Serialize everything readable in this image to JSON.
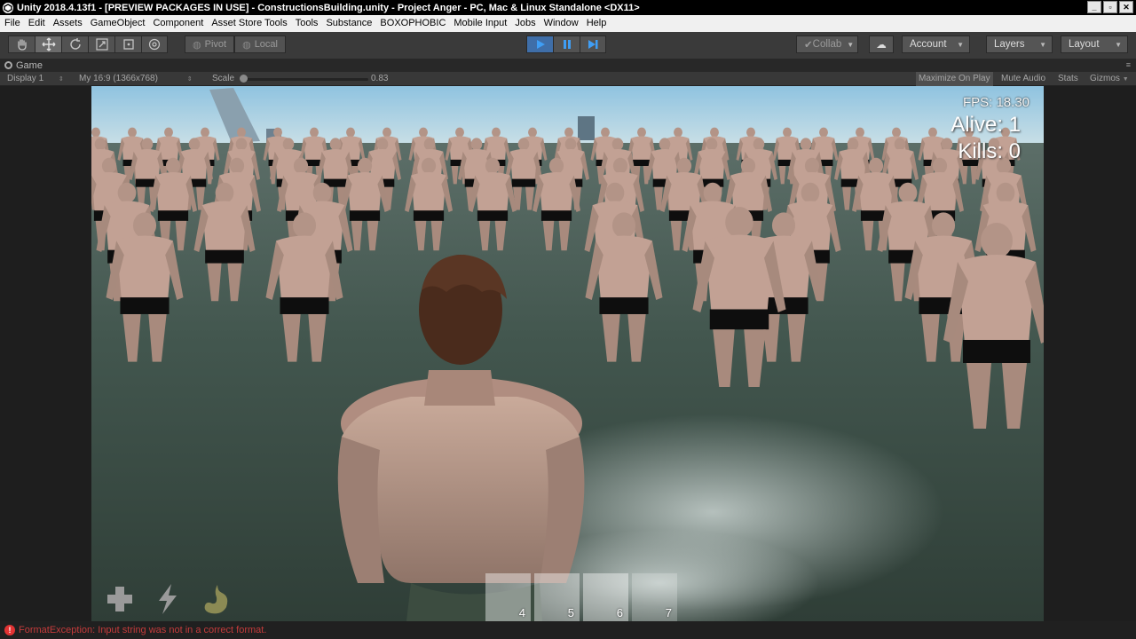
{
  "window": {
    "title": "Unity 2018.4.13f1 - [PREVIEW PACKAGES IN USE] - ConstructionsBuilding.unity - Project Anger - PC, Mac & Linux Standalone <DX11>"
  },
  "menu": [
    "File",
    "Edit",
    "Assets",
    "GameObject",
    "Component",
    "Asset Store Tools",
    "Tools",
    "Substance",
    "BOXOPHOBIC",
    "Mobile Input",
    "Jobs",
    "Window",
    "Help"
  ],
  "toolbar": {
    "pivot_label": "Pivot",
    "local_label": "Local",
    "collab_label": "Collab",
    "account_label": "Account",
    "layers_label": "Layers",
    "layout_label": "Layout"
  },
  "game_tab": {
    "label": "Game"
  },
  "game_toolbar": {
    "display": "Display 1",
    "resolution": "My 16:9 (1366x768)",
    "scale_label": "Scale",
    "scale_value": "0.83",
    "maximize": "Maximize On Play",
    "mute": "Mute Audio",
    "stats": "Stats",
    "gizmos": "Gizmos"
  },
  "hud": {
    "fps": "FPS: 18.30",
    "alive": "Alive: 1",
    "kills": "Kills: 0",
    "hotbar": [
      "4",
      "5",
      "6",
      "7"
    ]
  },
  "status": {
    "message": "FormatException: Input string was not in a correct format."
  },
  "colors": {
    "sky_top": "#9ecadf",
    "sea": "#3d4f47",
    "play_active": "#3f6ea8",
    "error": "#c43b3b"
  }
}
